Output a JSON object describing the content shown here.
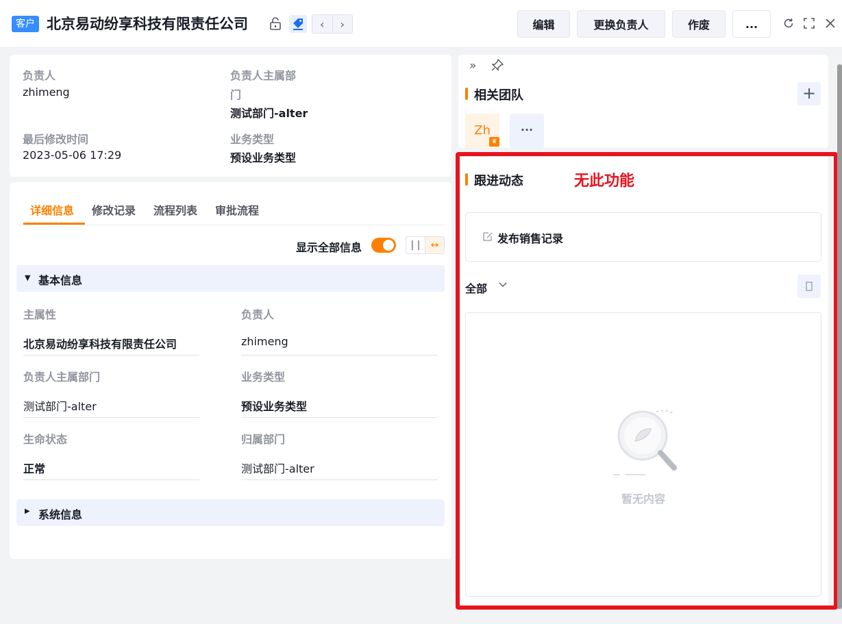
{
  "header": {
    "tag": "客户",
    "title": "北京易动纷享科技有限责任公司",
    "buttons": {
      "edit": "编辑",
      "change_owner": "更换负责人",
      "void": "作废",
      "more": "..."
    }
  },
  "summary": {
    "owner_label": "负责人",
    "owner_value": "zhimeng",
    "dept_label_1": "负责人主属部",
    "dept_label_2": "门",
    "dept_value": "测试部门-alter",
    "modified_label": "最后修改时间",
    "modified_value": "2023-05-06 17:29",
    "biz_label": "业务类型",
    "biz_value": "预设业务类型"
  },
  "tabs": [
    "详细信息",
    "修改记录",
    "流程列表",
    "审批流程"
  ],
  "show_all_label": "显示全部信息",
  "basic_section": {
    "title": "基本信息",
    "fields": [
      {
        "label": "主属性",
        "value": "北京易动纷享科技有限责任公司"
      },
      {
        "label": "负责人",
        "value": "zhimeng"
      },
      {
        "label": "负责人主属部门",
        "value": "测试部门-alter"
      },
      {
        "label": "业务类型",
        "value": "预设业务类型"
      },
      {
        "label": "生命状态",
        "value": "正常"
      },
      {
        "label": "归属部门",
        "value": "测试部门-alter"
      }
    ]
  },
  "system_section": {
    "title": "系统信息"
  },
  "team": {
    "title": "相关团队",
    "member_initials": "Zh",
    "more": "···"
  },
  "followup": {
    "title": "跟进动态",
    "annotation": "无此功能",
    "publish_label": "发布销售记录",
    "filter_label": "全部",
    "empty_text": "暂无内容"
  },
  "colors": {
    "accent": "#ff8000",
    "brand": "#368dff",
    "annotation_red": "#e8131d"
  }
}
